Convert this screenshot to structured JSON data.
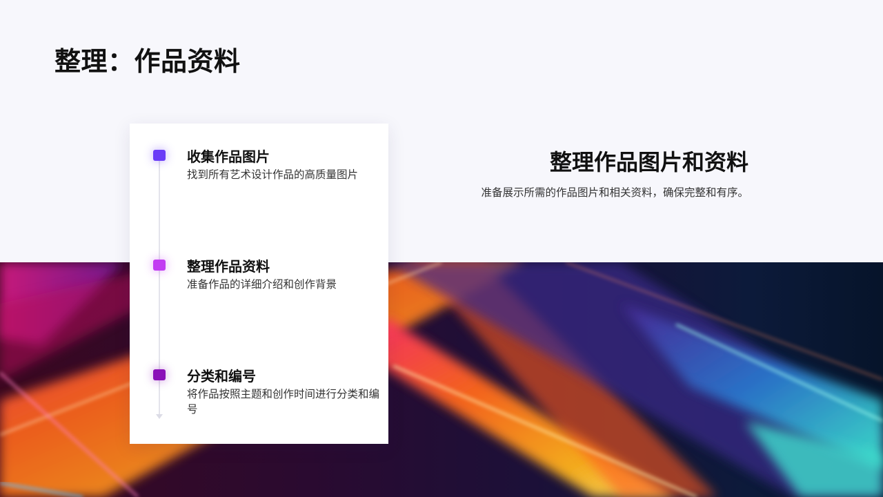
{
  "page": {
    "title": "整理：作品资料"
  },
  "timeline": {
    "steps": [
      {
        "title": "收集作品图片",
        "description": "找到所有艺术设计作品的高质量图片",
        "marker_color": "#6a3cf7"
      },
      {
        "title": "整理作品资料",
        "description": "准备作品的详细介绍和创作背景",
        "marker_color": "#c23cf2"
      },
      {
        "title": "分类和编号",
        "description": "将作品按照主题和创作时间进行分类和编号",
        "marker_color": "#8a10b8"
      }
    ]
  },
  "summary": {
    "heading": "整理作品图片和资料",
    "subtext": "准备展示所需的作品图片和相关资料，确保完整和有序。"
  },
  "colors": {
    "background": "#f7f7fc",
    "card": "#ffffff",
    "text_primary": "#111111",
    "text_secondary": "#333333"
  }
}
